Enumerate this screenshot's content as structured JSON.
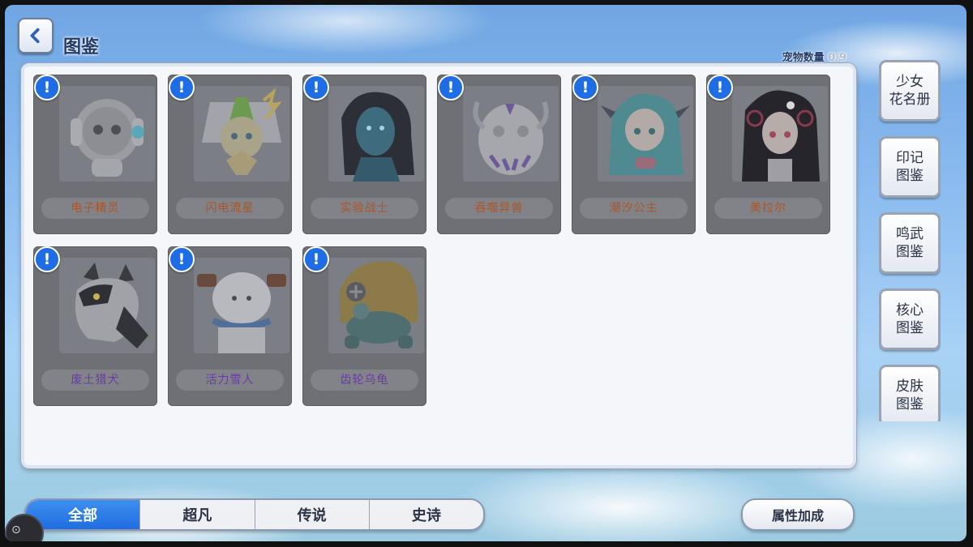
{
  "header": {
    "title": "图鉴"
  },
  "pet_count": {
    "label": "宠物数量",
    "value": "0/9"
  },
  "cards": [
    {
      "name": "电子精灵",
      "icon": "robot-pet-icon",
      "badge": "!"
    },
    {
      "name": "闪电流星",
      "icon": "lightning-pet-icon",
      "badge": "!"
    },
    {
      "name": "实验战士",
      "icon": "warrior-pet-icon",
      "badge": "!"
    },
    {
      "name": "吞噬异兽",
      "icon": "beast-egg-pet-icon",
      "badge": "!"
    },
    {
      "name": "潮汐公主",
      "icon": "mermaid-pet-icon",
      "badge": "!"
    },
    {
      "name": "美拉尔",
      "icon": "dark-girl-pet-icon",
      "badge": "!"
    },
    {
      "name": "废土猎犬",
      "icon": "wolf-pet-icon",
      "badge": "!"
    },
    {
      "name": "活力雪人",
      "icon": "snowman-pet-icon",
      "badge": "!"
    },
    {
      "name": "齿轮乌龟",
      "icon": "gear-turtle-pet-icon",
      "badge": "!"
    }
  ],
  "side_menu": [
    {
      "label": "少女\n花名册"
    },
    {
      "label": "印记\n图鉴"
    },
    {
      "label": "鸣武\n图鉴"
    },
    {
      "label": "核心\n图鉴"
    },
    {
      "label": "皮肤\n图鉴"
    }
  ],
  "tabs": [
    {
      "label": "全部",
      "active": true
    },
    {
      "label": "超凡",
      "active": false
    },
    {
      "label": "传说",
      "active": false
    },
    {
      "label": "史诗",
      "active": false
    }
  ],
  "attr_bonus_button": {
    "label": "属性加成"
  },
  "colors": {
    "accent": "#1f6de4",
    "name_orange": "#b3531f",
    "name_purple": "#6a3aa6"
  }
}
